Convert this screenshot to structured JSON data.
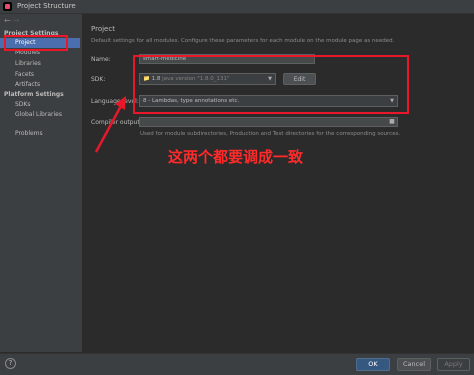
{
  "window": {
    "title": "Project Structure",
    "icon": "intellij-app-icon"
  },
  "nav": {
    "back": "←",
    "forward": "→"
  },
  "sidebar": {
    "project_settings_header": "Project Settings",
    "project_items": [
      {
        "label": "Project",
        "selected": true
      },
      {
        "label": "Modules"
      },
      {
        "label": "Libraries"
      },
      {
        "label": "Facets"
      },
      {
        "label": "Artifacts"
      }
    ],
    "platform_settings_header": "Platform Settings",
    "platform_items": [
      {
        "label": "SDKs"
      },
      {
        "label": "Global Libraries"
      }
    ],
    "problems_label": "Problems"
  },
  "main": {
    "heading": "Project",
    "description": "Default settings for all modules. Configure these parameters for each module on the module page as needed.",
    "name_label": "Name:",
    "name_value": "smart-medicine",
    "sdk_label": "SDK:",
    "sdk_value": "1.8",
    "sdk_detail": "java version \"1.8.0_131\"",
    "sdk_edit_label": "Edit",
    "language_level_label": "Language level:",
    "language_level_value": "8 - Lambdas, type annotations etc.",
    "compiler_output_label": "Compiler output:",
    "compiler_output_value": "",
    "compiler_output_hint": "Used for module subdirectories, Production and Test directories for the corresponding sources."
  },
  "annotation": {
    "text": "这两个都要调成一致",
    "color": "#ff2a2a"
  },
  "footer": {
    "help_label": "?",
    "ok_label": "OK",
    "cancel_label": "Cancel",
    "apply_label": "Apply"
  },
  "colors": {
    "background": "#2b2b2b",
    "panel": "#3c3f41",
    "selection": "#4b6eaf",
    "primary_button": "#365880",
    "highlight_red": "#e8182a"
  }
}
